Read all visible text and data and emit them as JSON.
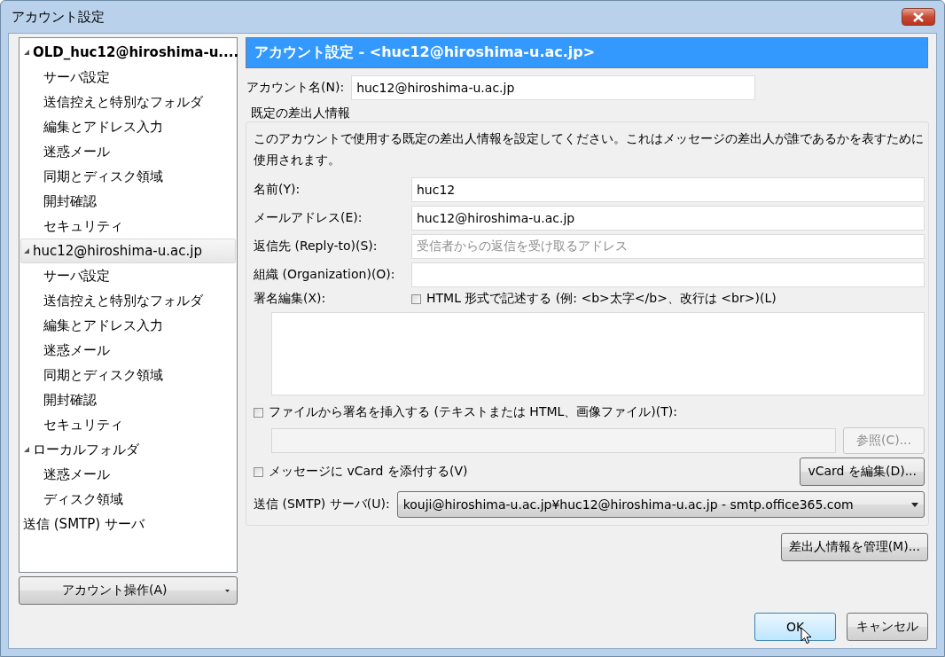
{
  "window": {
    "title": "アカウント設定"
  },
  "tree": [
    {
      "label": "OLD_huc12@hiroshima-u....",
      "default": true,
      "expanded": true,
      "selected": false,
      "children": [
        {
          "label": "サーバ設定",
          "selected": false
        },
        {
          "label": "送信控えと特別なフォルダ",
          "selected": false
        },
        {
          "label": "編集とアドレス入力",
          "selected": false
        },
        {
          "label": "迷惑メール",
          "selected": false
        },
        {
          "label": "同期とディスク領域",
          "selected": false
        },
        {
          "label": "開封確認",
          "selected": false
        },
        {
          "label": "セキュリティ",
          "selected": false
        }
      ]
    },
    {
      "label": "huc12@hiroshima-u.ac.jp",
      "default": false,
      "expanded": true,
      "selected": true,
      "children": [
        {
          "label": "サーバ設定",
          "selected": false
        },
        {
          "label": "送信控えと特別なフォルダ",
          "selected": false
        },
        {
          "label": "編集とアドレス入力",
          "selected": false
        },
        {
          "label": "迷惑メール",
          "selected": false
        },
        {
          "label": "同期とディスク領域",
          "selected": false
        },
        {
          "label": "開封確認",
          "selected": false
        },
        {
          "label": "セキュリティ",
          "selected": false
        }
      ]
    },
    {
      "label": "ローカルフォルダ",
      "default": false,
      "expanded": true,
      "selected": false,
      "children": [
        {
          "label": "迷惑メール",
          "selected": false
        },
        {
          "label": "ディスク領域",
          "selected": false
        }
      ]
    },
    {
      "label": "送信 (SMTP) サーバ",
      "default": false,
      "selected": false
    }
  ],
  "account_actions_button": {
    "label": "アカウント操作(A)"
  },
  "header": {
    "title": "アカウント設定 - <huc12@hiroshima-u.ac.jp>"
  },
  "account_name": {
    "label": "アカウント名(N):",
    "value": "huc12@hiroshima-u.ac.jp"
  },
  "identity": {
    "legend": "既定の差出人情報",
    "description": "このアカウントで使用する既定の差出人情報を設定してください。これはメッセージの差出人が誰であるかを表すために使用されます。",
    "fields": [
      {
        "label": "名前(Y):",
        "value": "huc12"
      },
      {
        "label": "メールアドレス(E):",
        "value": "huc12@hiroshima-u.ac.jp"
      },
      {
        "label": "返信先 (Reply-to)(S):",
        "placeholder": "受信者からの返信を受け取るアドレス"
      },
      {
        "label": "組織 (Organization)(O):"
      }
    ],
    "signature": {
      "label": "署名編集(X):",
      "html_checkbox": {
        "label": "HTML 形式で記述する (例: <b>太字</b>、改行は <br>)(L)",
        "checked": false
      }
    },
    "signature_file": {
      "label": "ファイルから署名を挿入する (テキストまたは HTML、画像ファイル)(T):",
      "checked": false
    },
    "browse_button": {
      "label": "参照(C)...",
      "disabled": true
    },
    "vcard": {
      "label": "メッセージに vCard を添付する(V)",
      "checked": false
    },
    "vcard_edit_button": {
      "label": "vCard を編集(D)..."
    },
    "smtp": {
      "label": "送信 (SMTP) サーバ(U):",
      "value": "kouji@hiroshima-u.ac.jp¥huc12@hiroshima-u.ac.jp - smtp.office365.com"
    }
  },
  "manage_button": {
    "label": "差出人情報を管理(M)..."
  },
  "buttons": [
    {
      "label": "OK",
      "default": true
    },
    {
      "label": "キャンセル",
      "default": false
    }
  ]
}
